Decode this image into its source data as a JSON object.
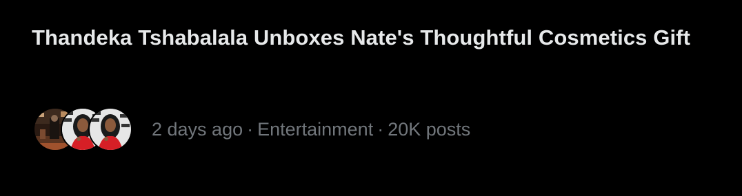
{
  "trend": {
    "title": "Thandeka Tshabalala Unboxes Nate's Thoughtful Cosmetics Gift",
    "time": "2 days ago",
    "separator": "·",
    "category": "Entertainment",
    "post_count": "20K posts"
  },
  "avatars": [
    {
      "icon": "avatar-photo-dark-interior"
    },
    {
      "icon": "avatar-photo-woman-red-dress"
    },
    {
      "icon": "avatar-photo-woman-red-dress"
    }
  ],
  "colors": {
    "background": "#000000",
    "title": "#e7e9ea",
    "meta": "#71767b"
  }
}
